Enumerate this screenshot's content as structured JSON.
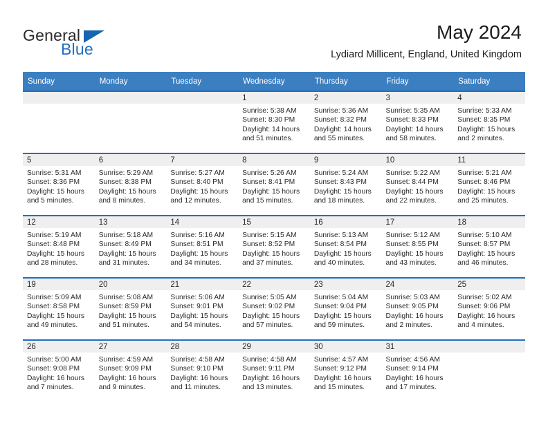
{
  "brand": {
    "name_part1": "General",
    "name_part2": "Blue",
    "triangle_icon": "triangle-icon",
    "accent_color": "#1565b0"
  },
  "header": {
    "title": "May 2024",
    "location": "Lydiard Millicent, England, United Kingdom"
  },
  "theme": {
    "header_blue": "#3c7fc1",
    "row_border_blue": "#1f6fc0",
    "daynum_band": "#efefef",
    "text": "#2a2a2a"
  },
  "columns": [
    "Sunday",
    "Monday",
    "Tuesday",
    "Wednesday",
    "Thursday",
    "Friday",
    "Saturday"
  ],
  "weeks": [
    [
      {
        "day": "",
        "empty": true
      },
      {
        "day": "",
        "empty": true
      },
      {
        "day": "",
        "empty": true
      },
      {
        "day": "1",
        "sunrise": "Sunrise: 5:38 AM",
        "sunset": "Sunset: 8:30 PM",
        "daylight_line1": "Daylight: 14 hours",
        "daylight_line2": "and 51 minutes."
      },
      {
        "day": "2",
        "sunrise": "Sunrise: 5:36 AM",
        "sunset": "Sunset: 8:32 PM",
        "daylight_line1": "Daylight: 14 hours",
        "daylight_line2": "and 55 minutes."
      },
      {
        "day": "3",
        "sunrise": "Sunrise: 5:35 AM",
        "sunset": "Sunset: 8:33 PM",
        "daylight_line1": "Daylight: 14 hours",
        "daylight_line2": "and 58 minutes."
      },
      {
        "day": "4",
        "sunrise": "Sunrise: 5:33 AM",
        "sunset": "Sunset: 8:35 PM",
        "daylight_line1": "Daylight: 15 hours",
        "daylight_line2": "and 2 minutes."
      }
    ],
    [
      {
        "day": "5",
        "sunrise": "Sunrise: 5:31 AM",
        "sunset": "Sunset: 8:36 PM",
        "daylight_line1": "Daylight: 15 hours",
        "daylight_line2": "and 5 minutes."
      },
      {
        "day": "6",
        "sunrise": "Sunrise: 5:29 AM",
        "sunset": "Sunset: 8:38 PM",
        "daylight_line1": "Daylight: 15 hours",
        "daylight_line2": "and 8 minutes."
      },
      {
        "day": "7",
        "sunrise": "Sunrise: 5:27 AM",
        "sunset": "Sunset: 8:40 PM",
        "daylight_line1": "Daylight: 15 hours",
        "daylight_line2": "and 12 minutes."
      },
      {
        "day": "8",
        "sunrise": "Sunrise: 5:26 AM",
        "sunset": "Sunset: 8:41 PM",
        "daylight_line1": "Daylight: 15 hours",
        "daylight_line2": "and 15 minutes."
      },
      {
        "day": "9",
        "sunrise": "Sunrise: 5:24 AM",
        "sunset": "Sunset: 8:43 PM",
        "daylight_line1": "Daylight: 15 hours",
        "daylight_line2": "and 18 minutes."
      },
      {
        "day": "10",
        "sunrise": "Sunrise: 5:22 AM",
        "sunset": "Sunset: 8:44 PM",
        "daylight_line1": "Daylight: 15 hours",
        "daylight_line2": "and 22 minutes."
      },
      {
        "day": "11",
        "sunrise": "Sunrise: 5:21 AM",
        "sunset": "Sunset: 8:46 PM",
        "daylight_line1": "Daylight: 15 hours",
        "daylight_line2": "and 25 minutes."
      }
    ],
    [
      {
        "day": "12",
        "sunrise": "Sunrise: 5:19 AM",
        "sunset": "Sunset: 8:48 PM",
        "daylight_line1": "Daylight: 15 hours",
        "daylight_line2": "and 28 minutes."
      },
      {
        "day": "13",
        "sunrise": "Sunrise: 5:18 AM",
        "sunset": "Sunset: 8:49 PM",
        "daylight_line1": "Daylight: 15 hours",
        "daylight_line2": "and 31 minutes."
      },
      {
        "day": "14",
        "sunrise": "Sunrise: 5:16 AM",
        "sunset": "Sunset: 8:51 PM",
        "daylight_line1": "Daylight: 15 hours",
        "daylight_line2": "and 34 minutes."
      },
      {
        "day": "15",
        "sunrise": "Sunrise: 5:15 AM",
        "sunset": "Sunset: 8:52 PM",
        "daylight_line1": "Daylight: 15 hours",
        "daylight_line2": "and 37 minutes."
      },
      {
        "day": "16",
        "sunrise": "Sunrise: 5:13 AM",
        "sunset": "Sunset: 8:54 PM",
        "daylight_line1": "Daylight: 15 hours",
        "daylight_line2": "and 40 minutes."
      },
      {
        "day": "17",
        "sunrise": "Sunrise: 5:12 AM",
        "sunset": "Sunset: 8:55 PM",
        "daylight_line1": "Daylight: 15 hours",
        "daylight_line2": "and 43 minutes."
      },
      {
        "day": "18",
        "sunrise": "Sunrise: 5:10 AM",
        "sunset": "Sunset: 8:57 PM",
        "daylight_line1": "Daylight: 15 hours",
        "daylight_line2": "and 46 minutes."
      }
    ],
    [
      {
        "day": "19",
        "sunrise": "Sunrise: 5:09 AM",
        "sunset": "Sunset: 8:58 PM",
        "daylight_line1": "Daylight: 15 hours",
        "daylight_line2": "and 49 minutes."
      },
      {
        "day": "20",
        "sunrise": "Sunrise: 5:08 AM",
        "sunset": "Sunset: 8:59 PM",
        "daylight_line1": "Daylight: 15 hours",
        "daylight_line2": "and 51 minutes."
      },
      {
        "day": "21",
        "sunrise": "Sunrise: 5:06 AM",
        "sunset": "Sunset: 9:01 PM",
        "daylight_line1": "Daylight: 15 hours",
        "daylight_line2": "and 54 minutes."
      },
      {
        "day": "22",
        "sunrise": "Sunrise: 5:05 AM",
        "sunset": "Sunset: 9:02 PM",
        "daylight_line1": "Daylight: 15 hours",
        "daylight_line2": "and 57 minutes."
      },
      {
        "day": "23",
        "sunrise": "Sunrise: 5:04 AM",
        "sunset": "Sunset: 9:04 PM",
        "daylight_line1": "Daylight: 15 hours",
        "daylight_line2": "and 59 minutes."
      },
      {
        "day": "24",
        "sunrise": "Sunrise: 5:03 AM",
        "sunset": "Sunset: 9:05 PM",
        "daylight_line1": "Daylight: 16 hours",
        "daylight_line2": "and 2 minutes."
      },
      {
        "day": "25",
        "sunrise": "Sunrise: 5:02 AM",
        "sunset": "Sunset: 9:06 PM",
        "daylight_line1": "Daylight: 16 hours",
        "daylight_line2": "and 4 minutes."
      }
    ],
    [
      {
        "day": "26",
        "sunrise": "Sunrise: 5:00 AM",
        "sunset": "Sunset: 9:08 PM",
        "daylight_line1": "Daylight: 16 hours",
        "daylight_line2": "and 7 minutes."
      },
      {
        "day": "27",
        "sunrise": "Sunrise: 4:59 AM",
        "sunset": "Sunset: 9:09 PM",
        "daylight_line1": "Daylight: 16 hours",
        "daylight_line2": "and 9 minutes."
      },
      {
        "day": "28",
        "sunrise": "Sunrise: 4:58 AM",
        "sunset": "Sunset: 9:10 PM",
        "daylight_line1": "Daylight: 16 hours",
        "daylight_line2": "and 11 minutes."
      },
      {
        "day": "29",
        "sunrise": "Sunrise: 4:58 AM",
        "sunset": "Sunset: 9:11 PM",
        "daylight_line1": "Daylight: 16 hours",
        "daylight_line2": "and 13 minutes."
      },
      {
        "day": "30",
        "sunrise": "Sunrise: 4:57 AM",
        "sunset": "Sunset: 9:12 PM",
        "daylight_line1": "Daylight: 16 hours",
        "daylight_line2": "and 15 minutes."
      },
      {
        "day": "31",
        "sunrise": "Sunrise: 4:56 AM",
        "sunset": "Sunset: 9:14 PM",
        "daylight_line1": "Daylight: 16 hours",
        "daylight_line2": "and 17 minutes."
      },
      {
        "day": "",
        "empty": true
      }
    ]
  ]
}
